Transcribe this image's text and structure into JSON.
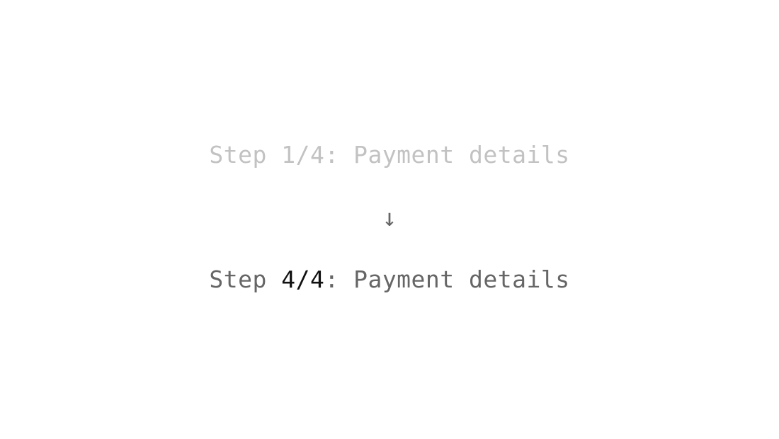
{
  "before": {
    "prefix": "Step ",
    "counter": "1/4",
    "suffix": ": Payment details"
  },
  "arrow": "↓",
  "after": {
    "prefix": "Step ",
    "counter": "4/4",
    "suffix": ": Payment details"
  },
  "colors": {
    "before_text": "#c2c2c2",
    "after_text": "#666666",
    "changed_text": "#111111",
    "arrow": "#666666",
    "background": "#ffffff"
  },
  "icons": {
    "arrow": "arrow-down-icon"
  }
}
